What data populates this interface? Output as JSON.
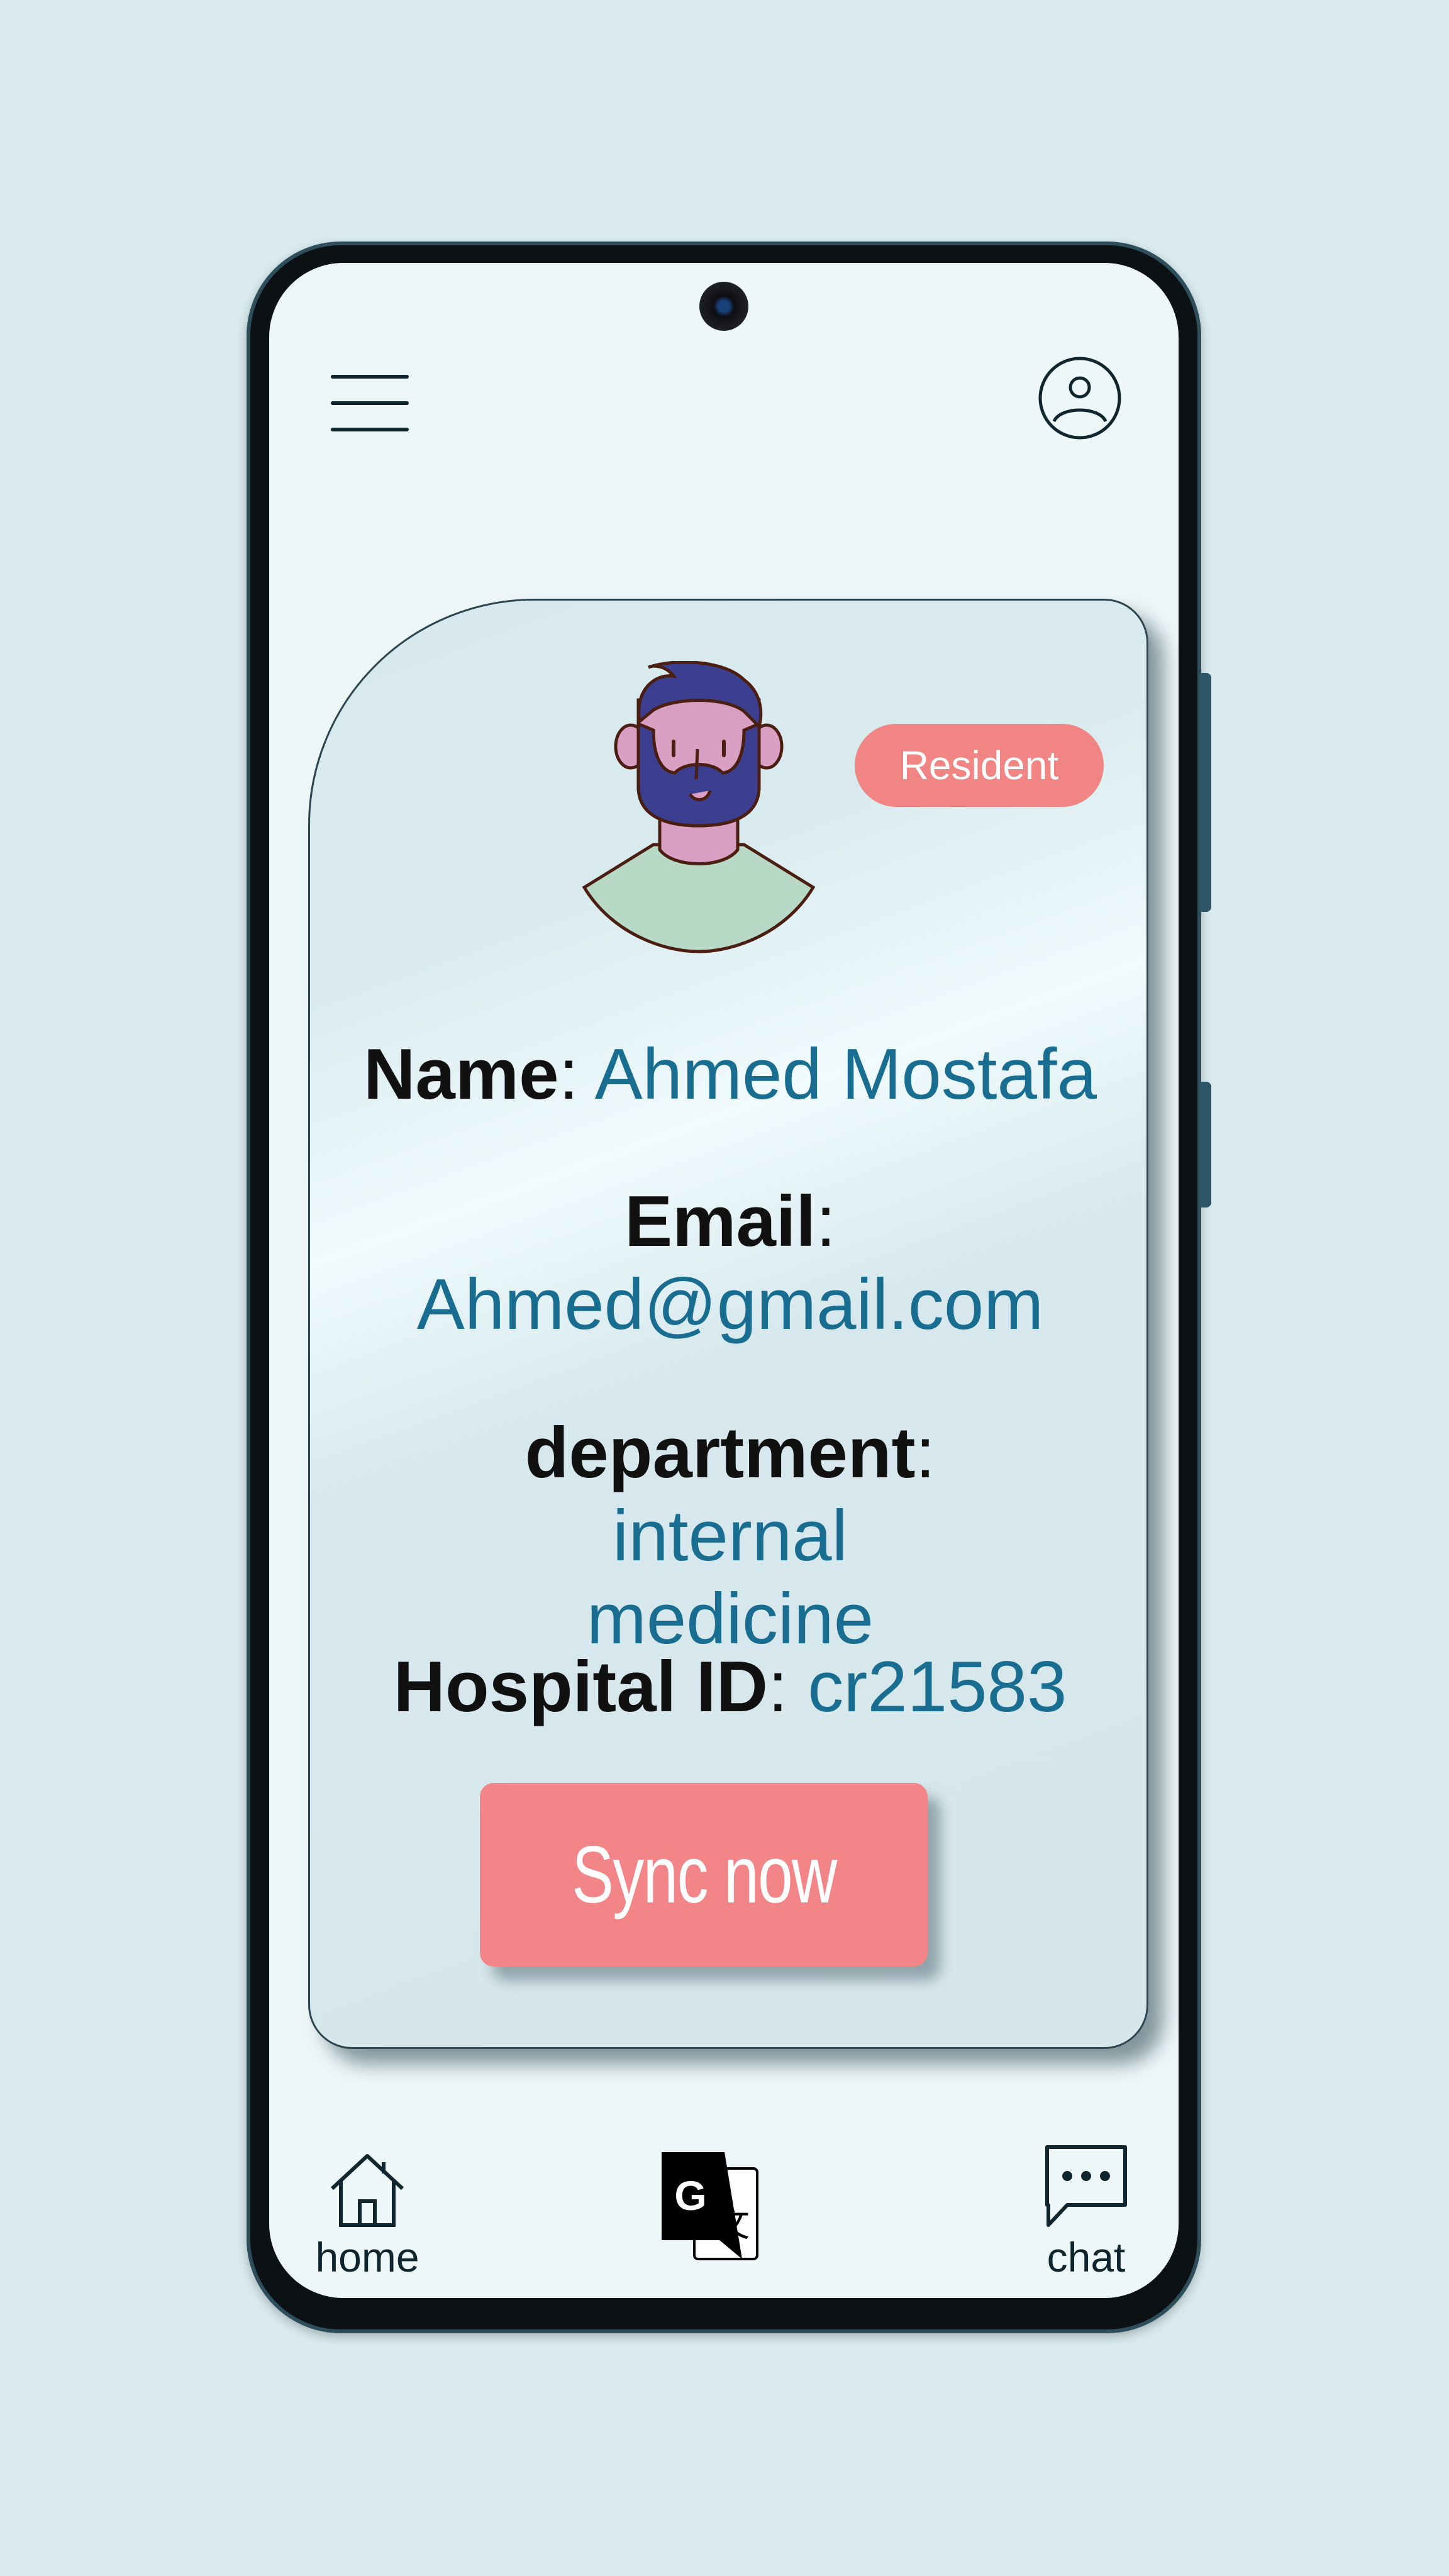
{
  "header": {
    "menu_icon": "hamburger-menu-icon",
    "profile_icon": "user-circle-icon"
  },
  "profile": {
    "badge": "Resident",
    "name_label": "Name",
    "name_value": "Ahmed Mostafa",
    "email_label": "Email",
    "email_value": "Ahmed@gmail.com",
    "department_label": "department",
    "department_value": "internal medicine",
    "hospital_id_label": "Hospital ID",
    "hospital_id_value": "cr21583",
    "separator": ":",
    "sync_button": "Sync now"
  },
  "bottom_nav": {
    "home_label": "home",
    "chat_label": "chat",
    "home_icon": "house-icon",
    "translate_icon": "google-translate-icon",
    "chat_icon": "chat-bubble-icon"
  },
  "colors": {
    "background": "#d9ebef",
    "accent_pink": "#f28587",
    "value_blue": "#186d90",
    "screen": "#eef7f8"
  }
}
